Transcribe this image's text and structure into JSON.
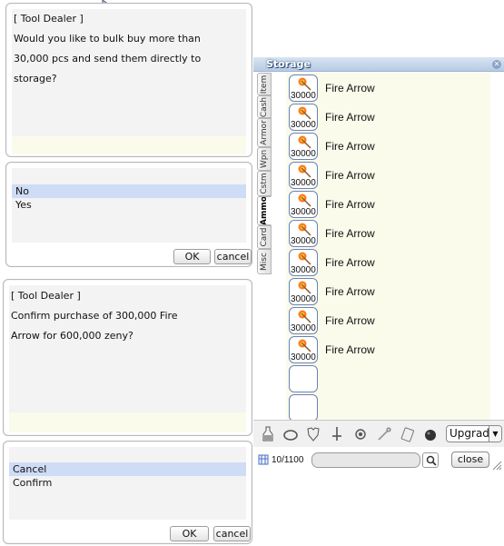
{
  "dialog1": {
    "lines": [
      "[ Tool Dealer ]",
      "Would you like to bulk buy more than",
      "30,000 pcs and send them directly to",
      "storage?"
    ]
  },
  "menu1": {
    "items": [
      "No",
      "Yes"
    ],
    "selected_index": 0,
    "ok_label": "OK",
    "cancel_label": "cancel"
  },
  "dialog2": {
    "lines": [
      "[ Tool Dealer ]",
      "Confirm purchase of 300,000 Fire",
      "Arrow for 600,000 zeny?"
    ]
  },
  "menu2": {
    "items": [
      "Cancel",
      "Confirm"
    ],
    "selected_index": 0,
    "ok_label": "OK",
    "cancel_label": "cancel"
  },
  "storage": {
    "title": "Storage",
    "tabs": [
      "Item",
      "Cash",
      "Armor",
      "Wpn",
      "Cstm",
      "Ammo",
      "Card",
      "Misc"
    ],
    "active_tab": "Ammo",
    "items": [
      {
        "name": "Fire Arrow",
        "qty": "30000",
        "icon": "fire-arrow-icon"
      },
      {
        "name": "Fire Arrow",
        "qty": "30000",
        "icon": "fire-arrow-icon"
      },
      {
        "name": "Fire Arrow",
        "qty": "30000",
        "icon": "fire-arrow-icon"
      },
      {
        "name": "Fire Arrow",
        "qty": "30000",
        "icon": "fire-arrow-icon"
      },
      {
        "name": "Fire Arrow",
        "qty": "30000",
        "icon": "fire-arrow-icon"
      },
      {
        "name": "Fire Arrow",
        "qty": "30000",
        "icon": "fire-arrow-icon"
      },
      {
        "name": "Fire Arrow",
        "qty": "30000",
        "icon": "fire-arrow-icon"
      },
      {
        "name": "Fire Arrow",
        "qty": "30000",
        "icon": "fire-arrow-icon"
      },
      {
        "name": "Fire Arrow",
        "qty": "30000",
        "icon": "fire-arrow-icon"
      },
      {
        "name": "Fire Arrow",
        "qty": "30000",
        "icon": "fire-arrow-icon"
      }
    ],
    "empty_slots": 2,
    "toolbar_icons": [
      "potion-icon",
      "ring-icon",
      "armor-icon",
      "sword-icon",
      "gear-icon",
      "wand-icon",
      "card-icon",
      "bomb-icon"
    ],
    "upgrade_label": "Upgrade",
    "count": "10/1100",
    "search_placeholder": "",
    "close_label": "close"
  },
  "colors": {
    "title_bar": "#c4d5ea",
    "list_bg": "#fbfbec",
    "selected_row": "#cfdcf6",
    "slot_border": "#6b83b3"
  }
}
